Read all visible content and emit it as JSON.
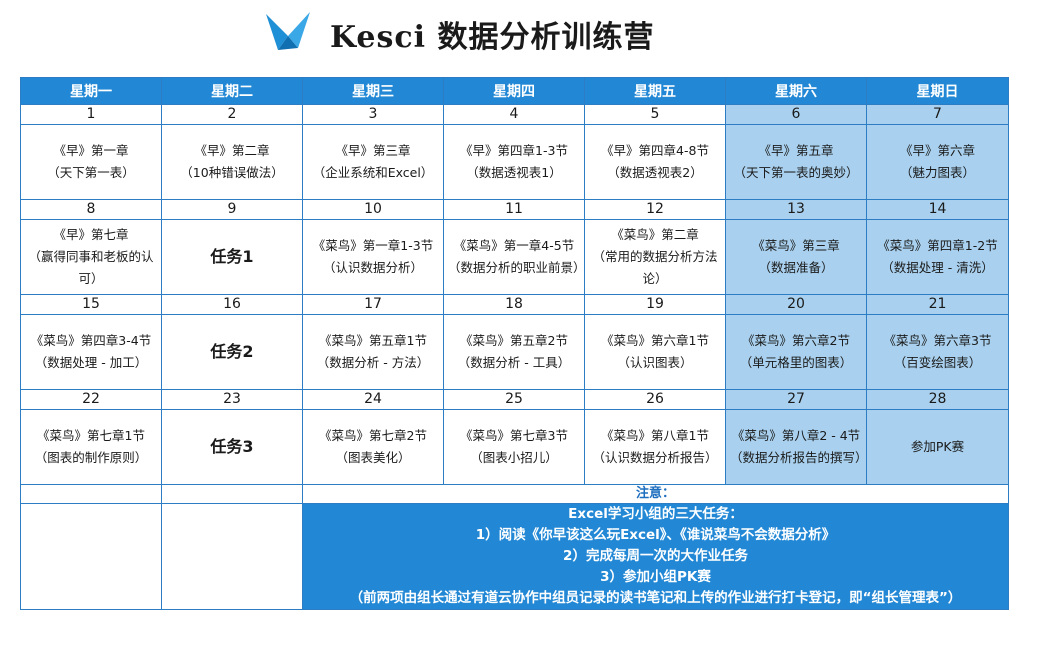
{
  "header": {
    "brand": "Kesci",
    "title_rest": " 数据分析训练营",
    "logo_icon": "bird-logo-icon"
  },
  "days": [
    "星期一",
    "星期二",
    "星期三",
    "星期四",
    "星期五",
    "星期六",
    "星期日"
  ],
  "weeks": [
    {
      "nums": [
        "1",
        "2",
        "3",
        "4",
        "5",
        "6",
        "7"
      ],
      "cells": [
        {
          "l1": "《早》第一章",
          "l2": "（天下第一表）"
        },
        {
          "l1": "《早》第二章",
          "l2": "（10种错误做法）"
        },
        {
          "l1": "《早》第三章",
          "l2": "（企业系统和Excel）"
        },
        {
          "l1": "《早》第四章1-3节",
          "l2": "（数据透视表1）"
        },
        {
          "l1": "《早》第四章4-8节",
          "l2": "（数据透视表2）"
        },
        {
          "l1": "《早》第五章",
          "l2": "（天下第一表的奥妙）"
        },
        {
          "l1": "《早》第六章",
          "l2": "（魅力图表）"
        }
      ]
    },
    {
      "nums": [
        "8",
        "9",
        "10",
        "11",
        "12",
        "13",
        "14"
      ],
      "cells": [
        {
          "l1": "《早》第七章",
          "l2": "（赢得同事和老板的认可）"
        },
        {
          "task": "任务1"
        },
        {
          "l1": "《菜鸟》第一章1-3节",
          "l2": "（认识数据分析）"
        },
        {
          "l1": "《菜鸟》第一章4-5节",
          "l2": "（数据分析的职业前景）"
        },
        {
          "l1": "《菜鸟》第二章",
          "l2": "（常用的数据分析方法论）"
        },
        {
          "l1": "《菜鸟》第三章",
          "l2": "（数据准备）"
        },
        {
          "l1": "《菜鸟》第四章1-2节",
          "l2": "（数据处理 - 清洗）"
        }
      ]
    },
    {
      "nums": [
        "15",
        "16",
        "17",
        "18",
        "19",
        "20",
        "21"
      ],
      "cells": [
        {
          "l1": "《菜鸟》第四章3-4节",
          "l2": "（数据处理 - 加工）"
        },
        {
          "task": "任务2"
        },
        {
          "l1": "《菜鸟》第五章1节",
          "l2": "（数据分析 - 方法）"
        },
        {
          "l1": "《菜鸟》第五章2节",
          "l2": "（数据分析 - 工具）"
        },
        {
          "l1": "《菜鸟》第六章1节",
          "l2": "（认识图表）"
        },
        {
          "l1": "《菜鸟》第六章2节",
          "l2": "（单元格里的图表）"
        },
        {
          "l1": "《菜鸟》第六章3节",
          "l2": "（百变绘图表）"
        }
      ]
    },
    {
      "nums": [
        "22",
        "23",
        "24",
        "25",
        "26",
        "27",
        "28"
      ],
      "cells": [
        {
          "l1": "《菜鸟》第七章1节",
          "l2": "（图表的制作原则）"
        },
        {
          "task": "任务3"
        },
        {
          "l1": "《菜鸟》第七章2节",
          "l2": "（图表美化）"
        },
        {
          "l1": "《菜鸟》第七章3节",
          "l2": "（图表小招儿）"
        },
        {
          "l1": "《菜鸟》第八章1节",
          "l2": "（认识数据分析报告）"
        },
        {
          "l1": "《菜鸟》第八章2 - 4节",
          "l2": "（数据分析报告的撰写）"
        },
        {
          "l1": "参加PK赛",
          "l2": ""
        }
      ]
    }
  ],
  "notes": {
    "label": "注意：",
    "lines": [
      "Excel学习小组的三大任务：",
      "1）阅读《你早该这么玩Excel》、《谁说菜鸟不会数据分析》",
      "2）完成每周一次的大作业任务",
      "3）参加小组PK赛",
      "（前两项由组长通过有道云协作中组员记录的读书笔记和上传的作业进行打卡登记，即“组长管理表”）"
    ]
  },
  "colors": {
    "header_blue": "#2288d5",
    "weekend_fill": "#a9d1ef",
    "border_blue": "#2c7dc4"
  }
}
